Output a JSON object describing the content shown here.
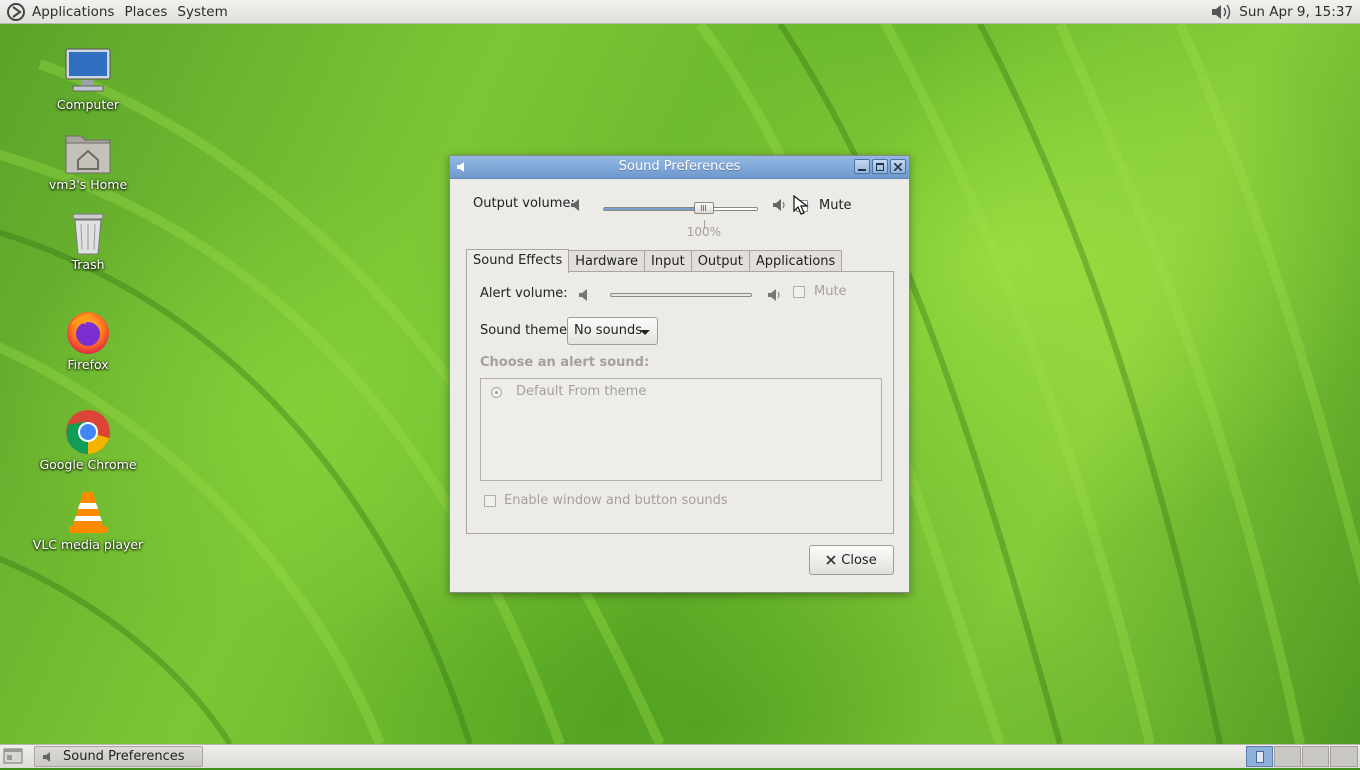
{
  "top_panel": {
    "menus": [
      "Applications",
      "Places",
      "System"
    ],
    "clock": "Sun Apr  9, 15:37"
  },
  "desktop_icons": [
    {
      "label": "Computer",
      "icon": "computer-icon"
    },
    {
      "label": "vm3's Home",
      "icon": "home-folder-icon"
    },
    {
      "label": "Trash",
      "icon": "trash-icon"
    },
    {
      "label": "Firefox",
      "icon": "firefox-icon"
    },
    {
      "label": "Google Chrome",
      "icon": "chrome-icon"
    },
    {
      "label": "VLC media player",
      "icon": "vlc-icon"
    }
  ],
  "dialog": {
    "title": "Sound Preferences",
    "output_volume_label": "Output volume:",
    "output_volume_percent": "100%",
    "output_volume_level": 0.65,
    "mute_label": "Mute",
    "tabs": [
      "Sound Effects",
      "Hardware",
      "Input",
      "Output",
      "Applications"
    ],
    "active_tab": "Sound Effects",
    "alert_volume_label": "Alert volume:",
    "alert_mute_label": "Mute",
    "sound_theme_label": "Sound theme:",
    "sound_theme_value": "No sounds",
    "choose_alert_label": "Choose an alert sound:",
    "alert_list": [
      {
        "name": "Default",
        "type": "From theme"
      }
    ],
    "enable_sounds_label": "Enable window and button sounds",
    "close_label": "Close"
  },
  "bottom_panel": {
    "task_label": "Sound Preferences",
    "workspace_count": 4,
    "active_workspace": 1
  },
  "colors": {
    "titlebar": "#7fa6d8",
    "wallpaper": "#6fbf2e",
    "panel": "#e8e6e3"
  }
}
